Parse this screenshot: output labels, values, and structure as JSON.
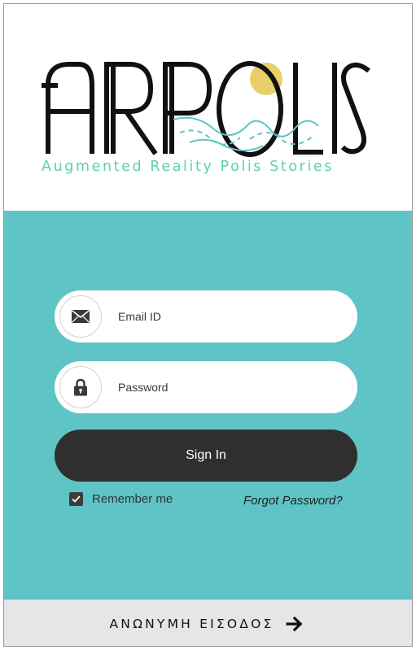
{
  "brand": {
    "logo_text": "ARPOLIS",
    "tagline": "Augmented Reality Polis Stories",
    "colors": {
      "logo_ink": "#111111",
      "sun": "#e8cf6a",
      "wave": "#5ec4c5",
      "tagline": "#5dd3a2"
    }
  },
  "login": {
    "email_placeholder": "Email ID",
    "password_placeholder": "Password",
    "email_icon": "envelope-icon",
    "password_icon": "lock-icon",
    "sign_in_label": "Sign In",
    "remember_label": "Remember me",
    "remember_checked": true,
    "forgot_label": "Forgot Password?"
  },
  "footer": {
    "anonymous_label": "ΑΝΩΝΥΜΗ ΕΙΣΟΔΟΣ",
    "arrow_icon": "arrow-right-icon"
  },
  "colors": {
    "panel": "#5ec4c5",
    "button": "#2f2f2f",
    "footer": "#e6e6e8"
  }
}
